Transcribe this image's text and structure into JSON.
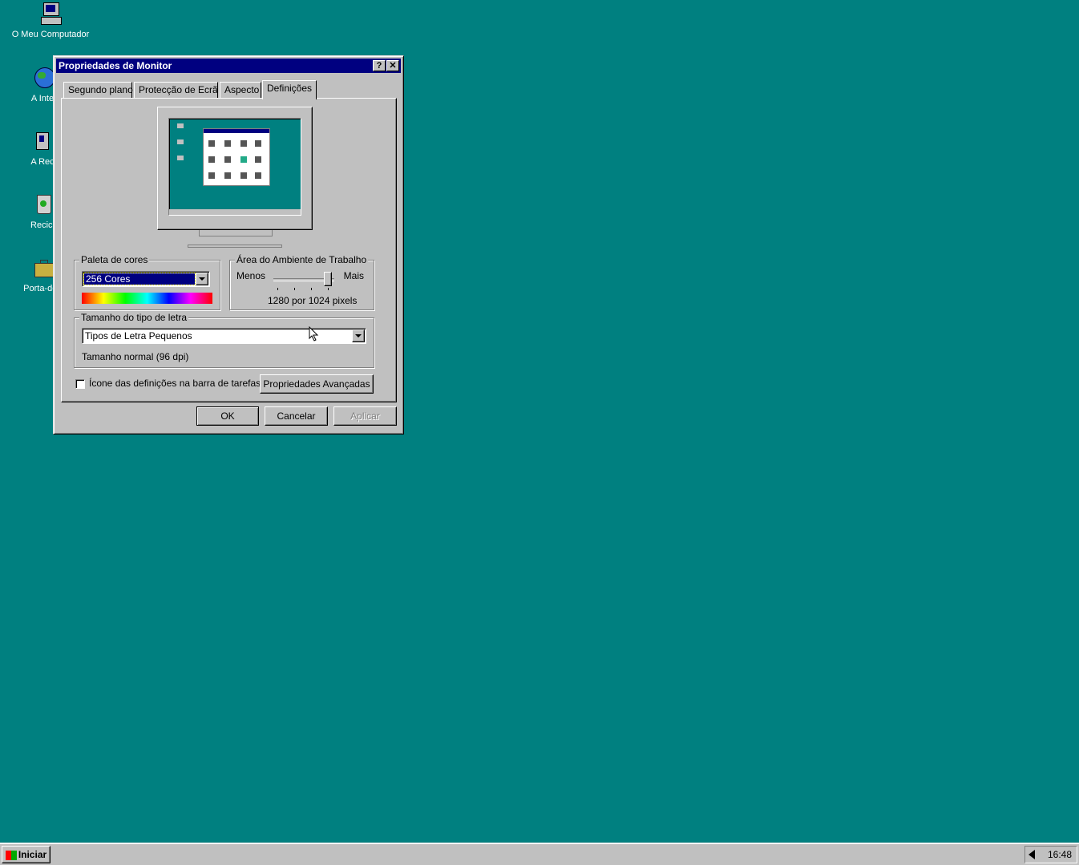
{
  "desktop": {
    "icons": [
      {
        "label": "O Meu Computador",
        "icon": "computer-icon"
      },
      {
        "label": "A Inte",
        "icon": "internet-icon"
      },
      {
        "label": "A Rec",
        "icon": "network-icon"
      },
      {
        "label": "Recicl",
        "icon": "recycle-bin-icon"
      },
      {
        "label": "Porta-doc",
        "icon": "briefcase-icon"
      }
    ]
  },
  "window": {
    "title": "Propriedades de Monitor",
    "help_btn": "?",
    "close_btn": "✕",
    "tabs": [
      "Segundo plano",
      "Protecção de Ecrã",
      "Aspecto",
      "Definições"
    ],
    "active_tab": "Definições",
    "color_palette": {
      "legend": "Paleta de cores",
      "selected": "256 Cores"
    },
    "desktop_area": {
      "legend": "Área do Ambiente de Trabalho",
      "less": "Menos",
      "more": "Mais",
      "resolution": "1280 por 1024 pixels",
      "slider_level": 0.95
    },
    "font_size": {
      "legend": "Tamanho do tipo de letra",
      "selected": "Tipos de Letra Pequenos",
      "description": "Tamanho normal (96 dpi)"
    },
    "taskbar_icon_checkbox": {
      "label": "Ícone das definições na barra de tarefas",
      "checked": false
    },
    "advanced_button": "Propriedades Avançadas",
    "ok": "OK",
    "cancel": "Cancelar",
    "apply": "Aplicar"
  },
  "taskbar": {
    "start": "Iniciar",
    "clock": "16:48"
  },
  "colors": {
    "desktop": "#008080",
    "titlebar": "#000080",
    "face": "#c0c0c0"
  }
}
